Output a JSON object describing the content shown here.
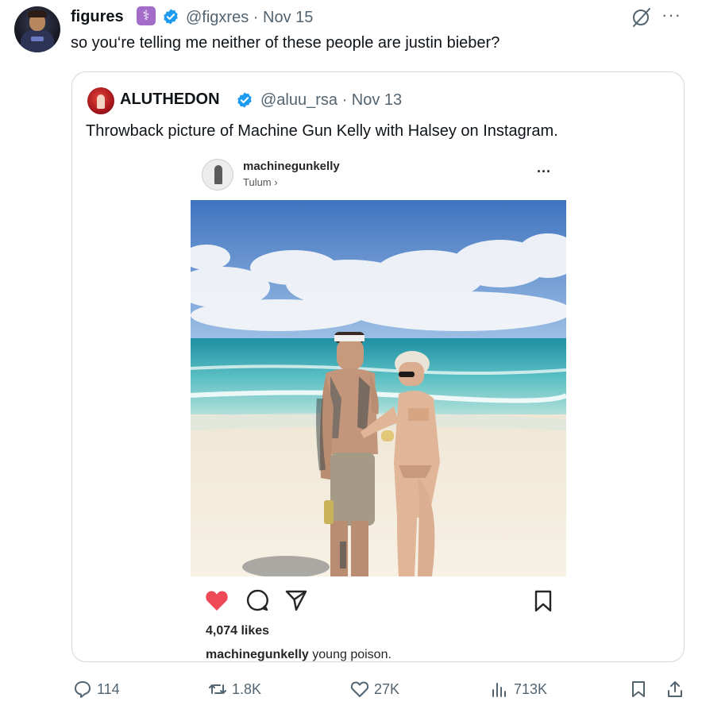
{
  "tweet": {
    "author_name": "figures",
    "author_badge_icon": "medical-badge-icon",
    "author_handle": "@figxres",
    "date": "· Nov 15",
    "text": "so you‘re telling me neither of these people are justin bieber?"
  },
  "quoted_tweet": {
    "author_name": "ALUTHEDON",
    "author_handle": "@aluu_rsa",
    "date": "· Nov 13",
    "text": "Throwback picture of Machine Gun Kelly with Halsey on Instagram.",
    "instagram": {
      "username": "machinegunkelly",
      "location": "Tulum ›",
      "more_label": "···",
      "likes": "4,074 likes",
      "caption_user": "machinegunkelly",
      "caption_text": " young poison."
    }
  },
  "actions": {
    "replies": "114",
    "reposts": "1.8K",
    "likes": "27K",
    "views": "713K"
  },
  "colors": {
    "verified_blue": "#1d9bf0",
    "muted_text": "#536471",
    "instagram_like_red": "#ed4956"
  }
}
